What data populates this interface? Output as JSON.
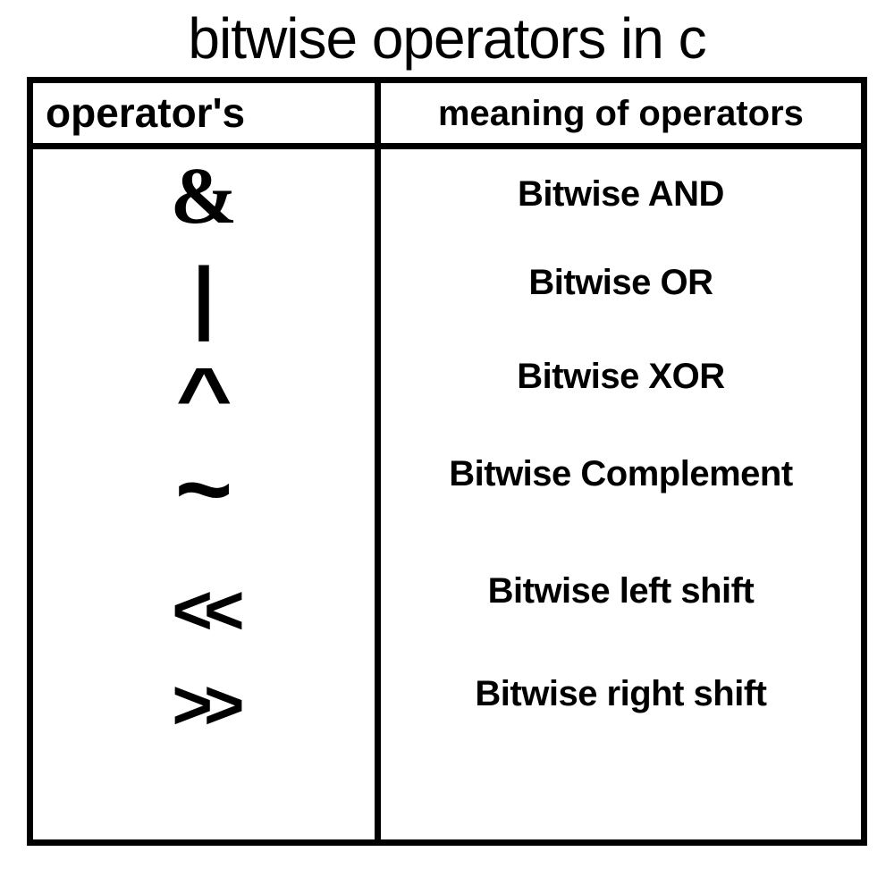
{
  "title": "bitwise operators in c",
  "headers": {
    "left": "operator's",
    "right": "meaning of operators"
  },
  "rows": [
    {
      "op": "&",
      "meaning": "Bitwise AND"
    },
    {
      "op": "|",
      "meaning": "Bitwise OR"
    },
    {
      "op": "^",
      "meaning": "Bitwise XOR"
    },
    {
      "op": "~",
      "meaning": "Bitwise Complement"
    },
    {
      "op": "<<",
      "meaning": "Bitwise left shift"
    },
    {
      "op": ">>",
      "meaning": "Bitwise right shift"
    }
  ]
}
